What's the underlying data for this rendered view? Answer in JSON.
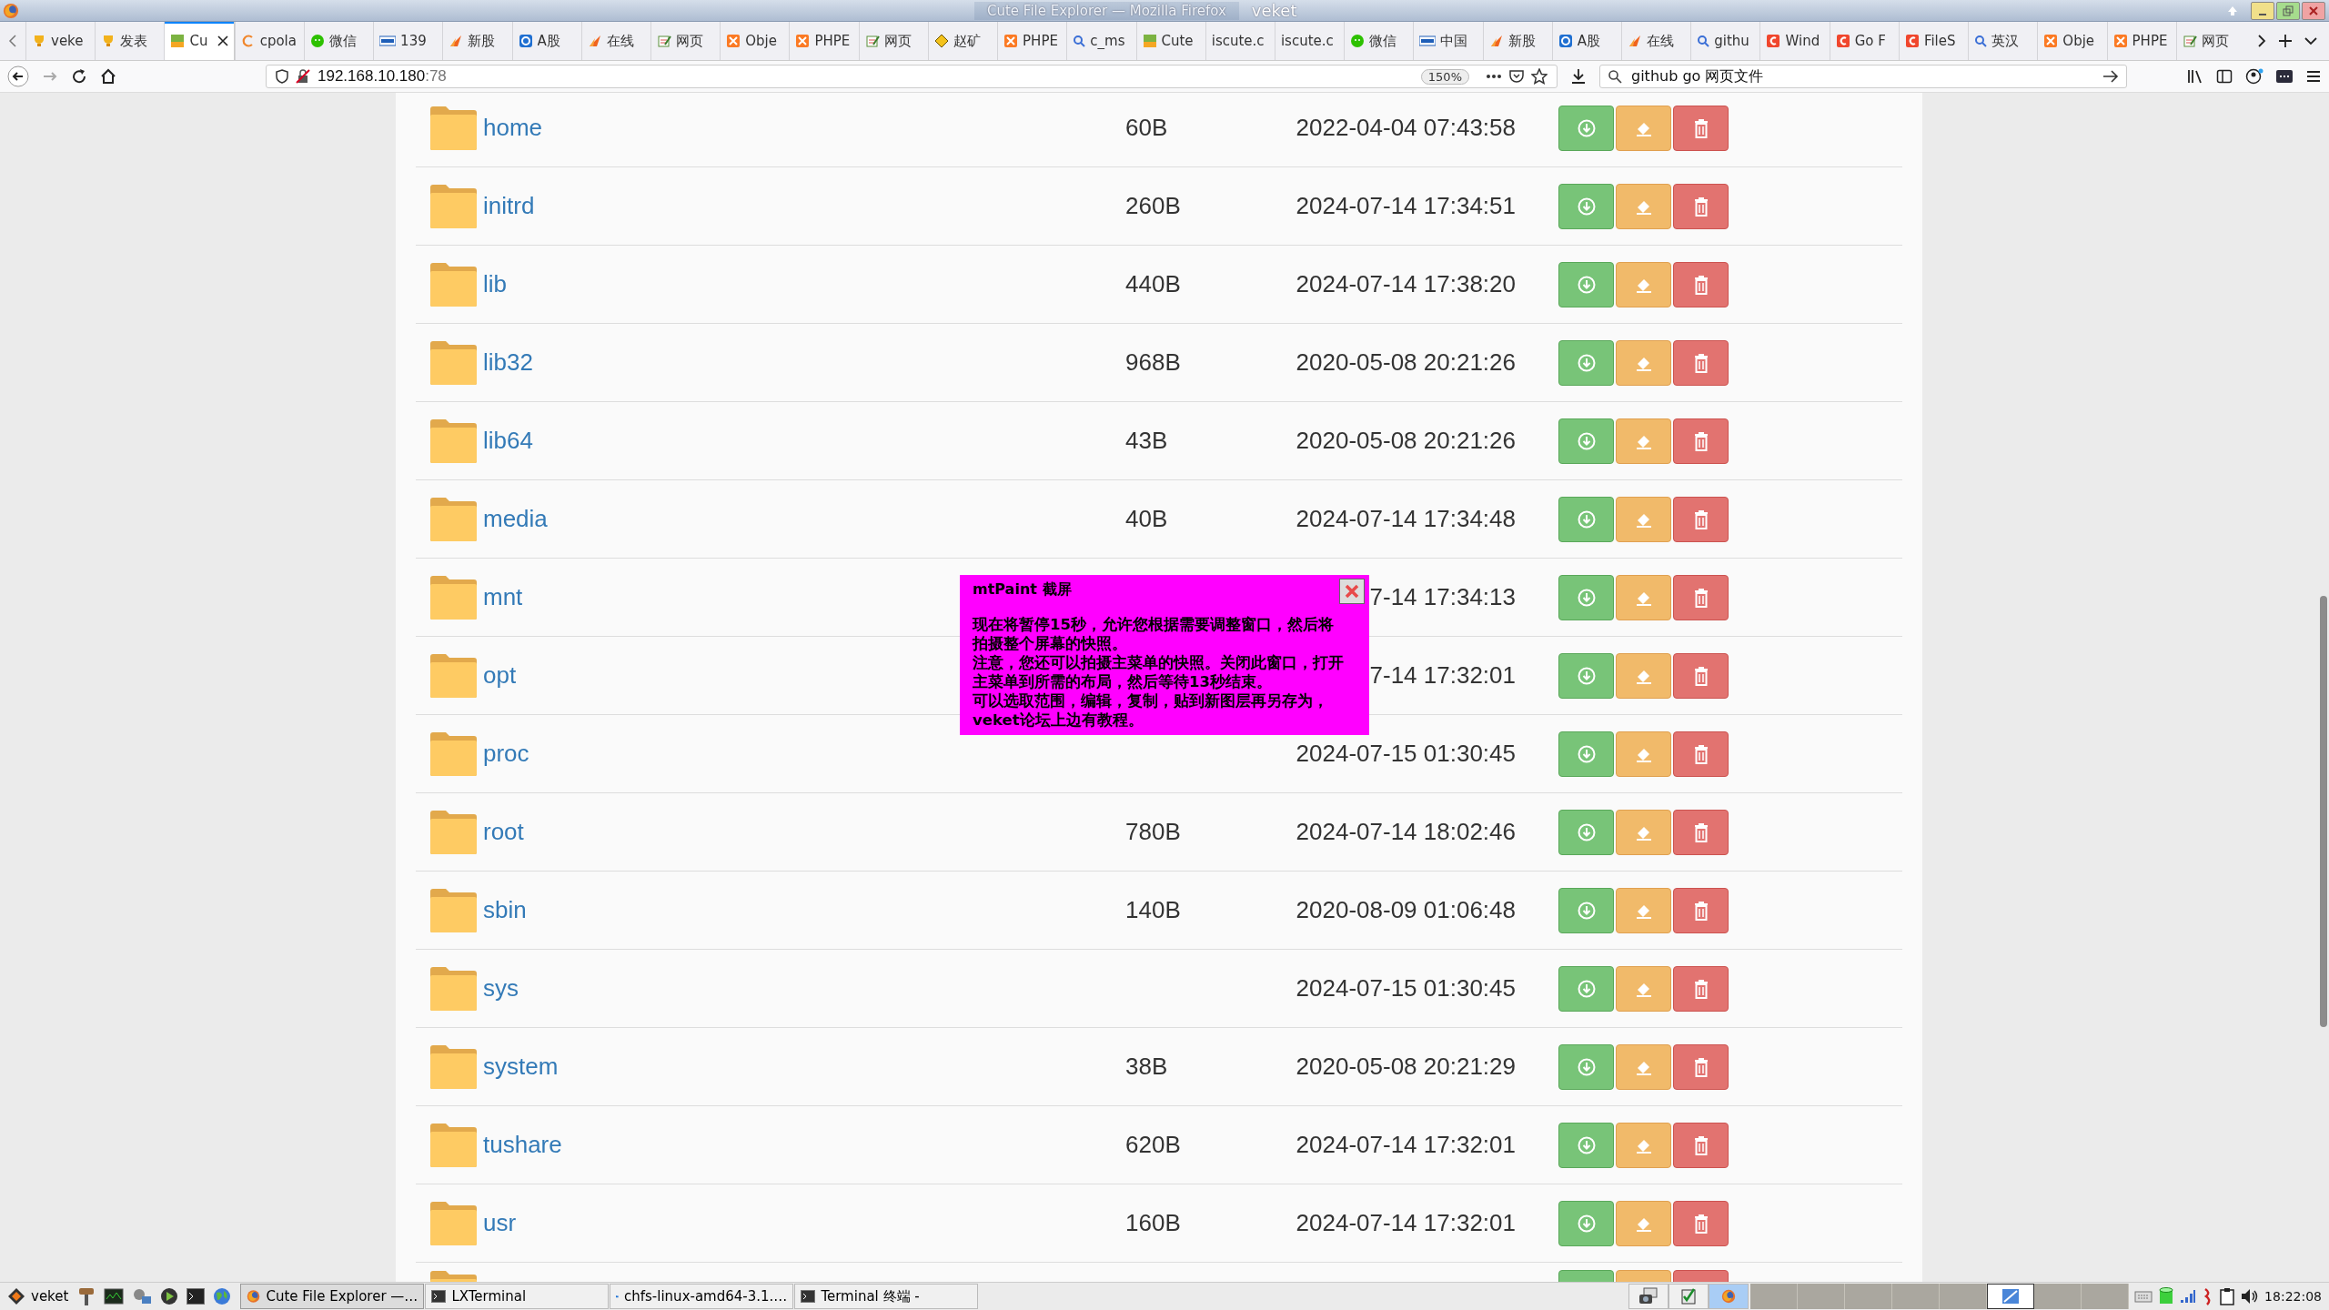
{
  "title_bar": {
    "title": "Cute File Explorer — Mozilla Firefox",
    "host": "veket"
  },
  "tabs": [
    {
      "label": "veke",
      "kind": "trophy",
      "selected": false
    },
    {
      "label": "发表",
      "kind": "trophy",
      "selected": false
    },
    {
      "label": "Cu",
      "kind": "cute",
      "selected": true
    },
    {
      "label": "cpola",
      "kind": "letter",
      "selected": false
    },
    {
      "label": "微信",
      "kind": "chat",
      "selected": false
    },
    {
      "label": "139",
      "kind": "mail",
      "selected": false
    },
    {
      "label": "新股",
      "kind": "bird",
      "selected": false
    },
    {
      "label": "A股",
      "kind": "square",
      "selected": false
    },
    {
      "label": "在线",
      "kind": "bird",
      "selected": false
    },
    {
      "label": "网页",
      "kind": "notepad",
      "selected": false
    },
    {
      "label": "Obje",
      "kind": "xampp",
      "selected": false
    },
    {
      "label": "PHPE",
      "kind": "xampp",
      "selected": false
    },
    {
      "label": "网页",
      "kind": "notepad",
      "selected": false
    },
    {
      "label": "赵矿",
      "kind": "diamond",
      "selected": false
    },
    {
      "label": "PHPE",
      "kind": "xampp",
      "selected": false
    },
    {
      "label": "c_ms",
      "kind": "search",
      "selected": false
    },
    {
      "label": "Cute",
      "kind": "cute",
      "selected": false
    },
    {
      "label": "iscute.c",
      "kind": "plain",
      "selected": false
    },
    {
      "label": "iscute.c",
      "kind": "plain",
      "selected": false
    },
    {
      "label": "微信",
      "kind": "chat",
      "selected": false
    },
    {
      "label": "中国",
      "kind": "mail",
      "selected": false
    },
    {
      "label": "新股",
      "kind": "bird",
      "selected": false
    },
    {
      "label": "A股",
      "kind": "square",
      "selected": false
    },
    {
      "label": "在线",
      "kind": "bird",
      "selected": false
    },
    {
      "label": "githu",
      "kind": "search",
      "selected": false
    },
    {
      "label": "Wind",
      "kind": "redc",
      "selected": false
    },
    {
      "label": "Go F",
      "kind": "redc",
      "selected": false
    },
    {
      "label": "FileS",
      "kind": "redc",
      "selected": false
    },
    {
      "label": "英汉",
      "kind": "search",
      "selected": false
    },
    {
      "label": "Obje",
      "kind": "xampp",
      "selected": false
    },
    {
      "label": "PHPE",
      "kind": "xampp",
      "selected": false
    },
    {
      "label": "网页",
      "kind": "notepad",
      "selected": false
    }
  ],
  "nav": {
    "url_host": "192.168.10.180",
    "url_port": ":78",
    "zoom": "150%",
    "search": "github go 网页文件"
  },
  "files": [
    {
      "kind": "folder",
      "name": "home",
      "size": "60B",
      "date": "2022-04-04 07:43:58"
    },
    {
      "kind": "folder",
      "name": "initrd",
      "size": "260B",
      "date": "2024-07-14 17:34:51"
    },
    {
      "kind": "folder",
      "name": "lib",
      "size": "440B",
      "date": "2024-07-14 17:38:20"
    },
    {
      "kind": "folder",
      "name": "lib32",
      "size": "968B",
      "date": "2020-05-08 20:21:26"
    },
    {
      "kind": "folder",
      "name": "lib64",
      "size": "43B",
      "date": "2020-05-08 20:21:26"
    },
    {
      "kind": "folder",
      "name": "media",
      "size": "40B",
      "date": "2024-07-14 17:34:48"
    },
    {
      "kind": "folder",
      "name": "mnt",
      "date": "7-14 17:34:13"
    },
    {
      "kind": "folder",
      "name": "opt",
      "date": "7-14 17:32:01"
    },
    {
      "kind": "folder",
      "name": "proc",
      "date": "2024-07-15 01:30:45"
    },
    {
      "kind": "folder",
      "name": "root",
      "size": "780B",
      "date": "2024-07-14 18:02:46"
    },
    {
      "kind": "folder",
      "name": "sbin",
      "size": "140B",
      "date": "2020-08-09 01:06:48"
    },
    {
      "kind": "folder",
      "name": "sys",
      "date": "2024-07-15 01:30:45"
    },
    {
      "kind": "folder",
      "name": "system",
      "size": "38B",
      "date": "2020-05-08 20:21:29"
    },
    {
      "kind": "folder",
      "name": "tushare",
      "size": "620B",
      "date": "2024-07-14 17:32:01"
    },
    {
      "kind": "folder",
      "name": "usr",
      "size": "160B",
      "date": "2024-07-14 17:32:01"
    },
    {
      "kind": "partial"
    }
  ],
  "dialog": {
    "title": "mtPaint 截屏",
    "paragraphs": [
      "现在将暂停15秒，允许您根据需要调整窗口，然后将拍摄整个屏幕的快照。",
      "注意，您还可以拍摄主菜单的快照。关闭此窗口，打开主菜单到所需的布局，然后等待13秒结束。",
      "可以选取范围，编辑，复制，贴到新图层再另存为，veket论坛上边有教程。"
    ]
  },
  "taskbar": {
    "start": "veket",
    "windows": [
      {
        "label": "Cute File Explorer —…",
        "kind": "firefox",
        "selected": true
      },
      {
        "label": "LXTerminal",
        "kind": "terminal",
        "selected": false
      },
      {
        "label": "chfs-linux-amd64-3.1.…",
        "kind": "folder",
        "selected": false
      },
      {
        "label": "Terminal 终端 -",
        "kind": "terminal",
        "selected": false
      }
    ],
    "tray_apps": [
      {
        "kind": "camera",
        "selected": false
      },
      {
        "kind": "check",
        "selected": false
      },
      {
        "kind": "firefox",
        "selected": true
      }
    ],
    "desktops": [
      {
        "selected": false
      },
      {
        "selected": false
      },
      {
        "selected": false
      },
      {
        "selected": false
      },
      {
        "selected": false
      },
      {
        "selected": true
      },
      {
        "selected": false
      },
      {
        "selected": false
      }
    ],
    "clock": "18:22:08"
  }
}
